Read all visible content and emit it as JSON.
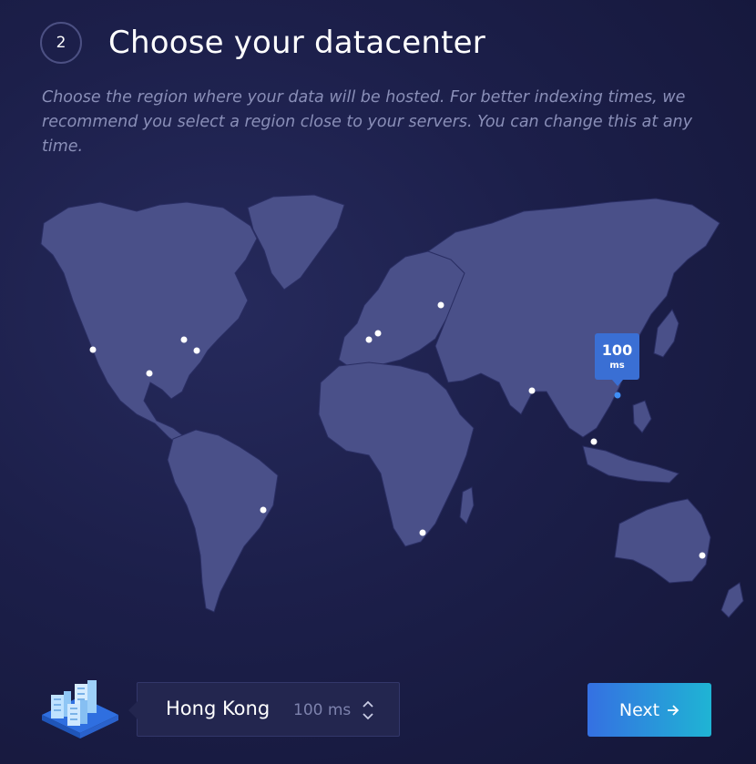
{
  "step": {
    "number": "2",
    "title": "Choose your datacenter"
  },
  "description": "Choose the region where your data will be hosted. For better indexing times, we recommend you select a region close to your servers. You can change this at any time.",
  "map": {
    "tooltip": {
      "value": "100",
      "unit": "ms"
    }
  },
  "selector": {
    "region": "Hong Kong",
    "latency": "100 ms"
  },
  "next_button": {
    "label": "Next",
    "icon": "arrow-right-icon"
  },
  "colors": {
    "land": "#4a5089",
    "accent": "#3a6fd4",
    "gradient_end": "#1fb4d4"
  }
}
